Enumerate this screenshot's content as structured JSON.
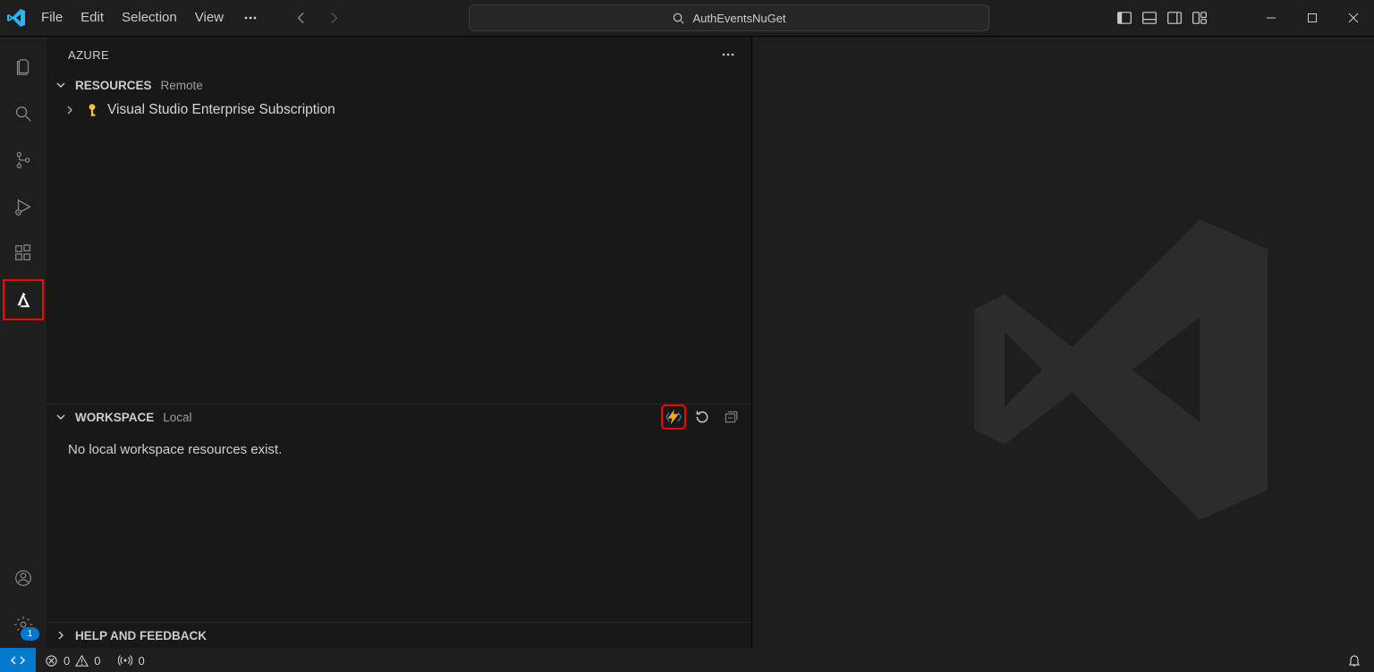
{
  "title": {
    "project": "AuthEventsNuGet"
  },
  "menu": {
    "file": "File",
    "edit": "Edit",
    "selection": "Selection",
    "view": "View"
  },
  "azure": {
    "panel_title": "AZURE",
    "resources": {
      "title": "RESOURCES",
      "tag": "Remote",
      "item": "Visual Studio Enterprise Subscription"
    },
    "workspace": {
      "title": "WORKSPACE",
      "tag": "Local",
      "empty": "No local workspace resources exist."
    },
    "help": {
      "title": "HELP AND FEEDBACK"
    }
  },
  "status": {
    "errors": "0",
    "warnings": "0",
    "ports": "0"
  },
  "badges": {
    "settings": "1"
  },
  "colors": {
    "accent": "#007acc",
    "highlight": "#ff0000",
    "functions": "#f5a623"
  }
}
